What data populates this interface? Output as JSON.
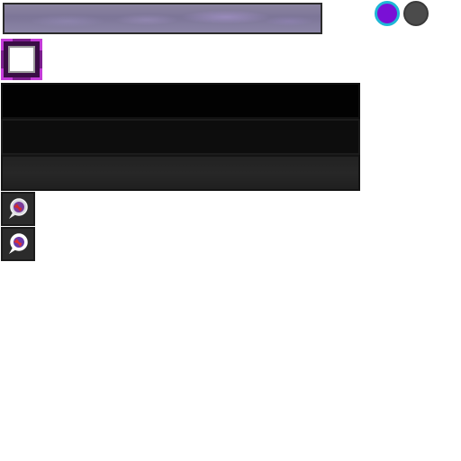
{
  "hud": {
    "top_bar": {
      "label": "",
      "colors": {
        "base": "#8a84a0",
        "highlight": "#b09ad8"
      }
    },
    "toggles": [
      {
        "name": "purple",
        "color": "#7a10d6",
        "ring": "#1fb7d6",
        "active": true
      },
      {
        "name": "gray",
        "color": "#4b4b4b",
        "active": false
      }
    ],
    "selected_slot": {
      "frame_color": "#c33bd8",
      "fill": "#ffffff"
    },
    "panels": [
      {
        "label": "",
        "color": "#020202"
      },
      {
        "label": "",
        "color": "#0d0d0d"
      },
      {
        "label": "",
        "color": "#242424"
      }
    ],
    "buttons": [
      {
        "icon": "chat-bubble-icon"
      },
      {
        "icon": "chat-bubble-icon"
      }
    ]
  }
}
